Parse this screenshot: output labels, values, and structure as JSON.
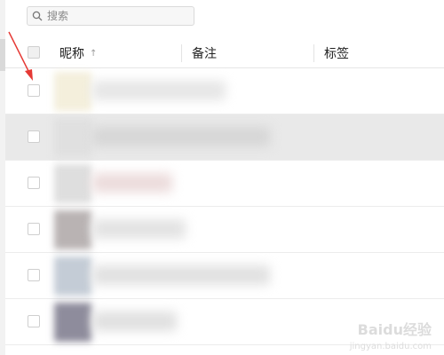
{
  "search": {
    "placeholder": "搜索"
  },
  "table": {
    "columns": [
      {
        "label": "昵称",
        "sort_icon": "arrow-up-icon"
      },
      {
        "label": "备注"
      },
      {
        "label": "标签"
      }
    ],
    "rows": [
      {
        "selected": false,
        "avatar_color": "#f4efdc",
        "nick_color": "#e6e6e6"
      },
      {
        "selected": true,
        "avatar_color": "#e0e0e0",
        "nick_color": "#d6d6d6"
      },
      {
        "selected": false,
        "avatar_color": "#dedede",
        "nick_color": "#ecdcdc"
      },
      {
        "selected": false,
        "avatar_color": "#b9b3b3",
        "nick_color": "#e3e3e3"
      },
      {
        "selected": false,
        "avatar_color": "#c4ccd6",
        "nick_color": "#e1e1e1"
      },
      {
        "selected": false,
        "avatar_color": "#8e8c9c",
        "nick_color": "#e0e0e0"
      }
    ]
  },
  "annotation": {
    "arrow_color": "#e53935"
  },
  "watermark": {
    "brand": "Baidu经验",
    "url": "jingyan.baidu.com"
  }
}
